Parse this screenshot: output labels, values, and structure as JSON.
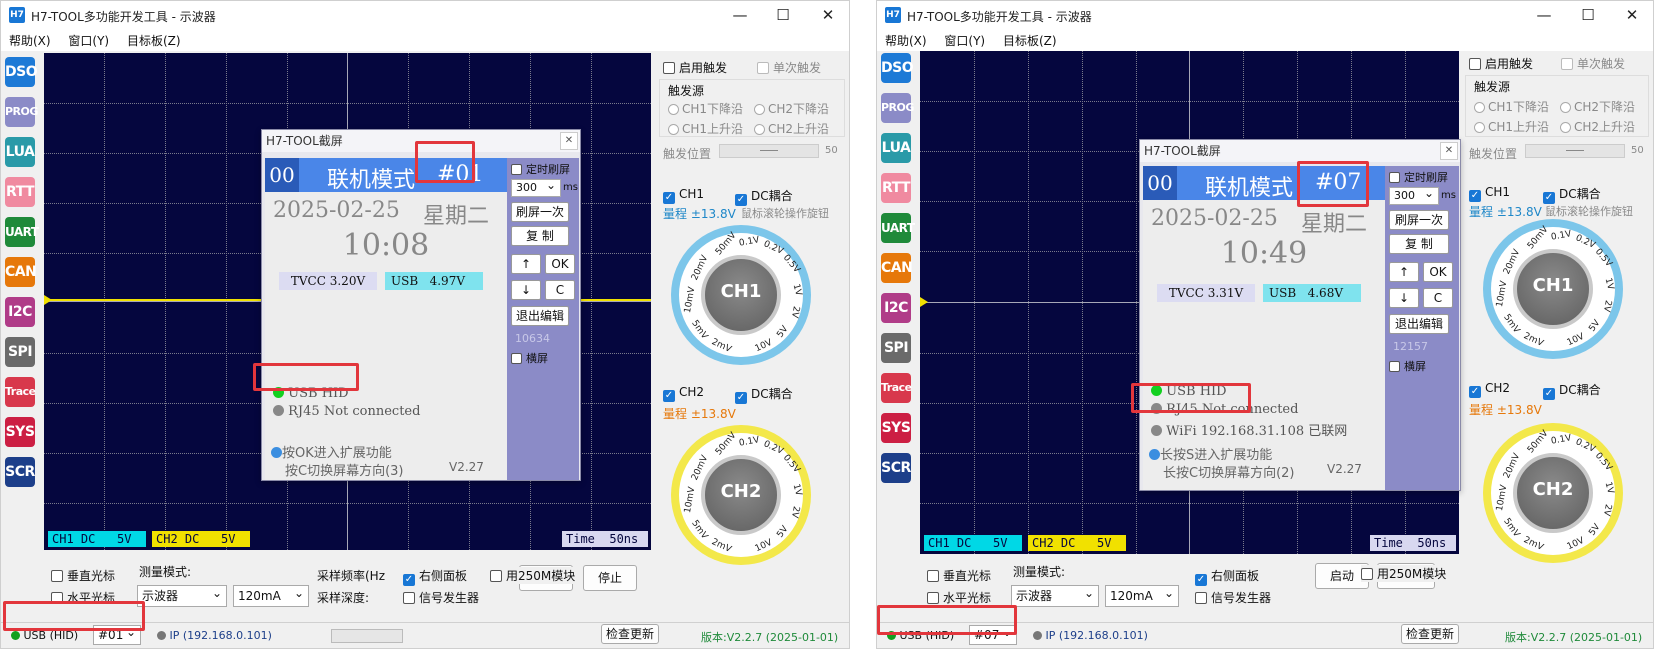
{
  "app": {
    "title": "H7-TOOL多功能开发工具 - 示波器",
    "icon": "H7",
    "menu": [
      "帮助(X)",
      "窗口(Y)",
      "目标板(Z)"
    ]
  },
  "sidebar": [
    "DSO",
    "PROG",
    "LUA",
    "RTT",
    "UART",
    "CAN",
    "I2C",
    "SPI",
    "Trace",
    "SYS",
    "SCR"
  ],
  "sidebar_colors": [
    "#1d7ad6",
    "#8b8bc7",
    "#2a9aa8",
    "#f08aa0",
    "#1f8a3a",
    "#e6780a",
    "#b03c88",
    "#6a6a6a",
    "#d8384c",
    "#cc1f43",
    "#1d3f8a"
  ],
  "scope": {
    "ch1_status": "CH1 DC   5V",
    "ch2_status": "CH2 DC   5V",
    "time_status": "Time  50ns"
  },
  "right": {
    "trigger_enable": "启用触发",
    "single_trigger": "单次触发",
    "trigger_source": "触发源",
    "ch1_fall": "CH1下降沿",
    "ch2_fall": "CH2下降沿",
    "ch1_rise": "CH1上升沿",
    "ch2_rise": "CH2上升沿",
    "trigger_pos": "触发位置",
    "trigger_pos_value": "50",
    "ch1": "CH1",
    "dc_couple": "DC耦合",
    "range1": "量程 ±13.8V",
    "wheel_hint": "鼠标滚轮操作旋钮",
    "ch2": "CH2",
    "range2": "量程 ±13.8V"
  },
  "knob": {
    "ch1": "CH1",
    "ch2": "CH2",
    "ticks": [
      "10mV",
      "20mV",
      "50mV",
      "0.1V",
      "0.2V",
      "0.5V",
      "1V",
      "2V",
      "5V",
      "10V",
      "2mV",
      "5mV"
    ]
  },
  "bottom": {
    "cursor_v": "垂直光标",
    "cursor_h": "水平光标",
    "measure_mode": "测量模式:",
    "mode_value": "示波器",
    "current_value": "120mA",
    "sample_rate": "采样频率(Hz",
    "sample_depth": "采样深度:",
    "right_panel": "右侧面板",
    "signal_gen": "信号发生器",
    "use_250m": "用250M模块",
    "stop": "停止",
    "start": "启动"
  },
  "status": {
    "usb": "USB (HID)",
    "ip": "IP (192.168.0.101)",
    "check_update": "检查更新",
    "version": "版本:V2.2.7 (2025-01-01)"
  },
  "popup": {
    "title": "H7-TOOL截屏",
    "timed_refresh": "定时刷屏",
    "refresh_ms": "300",
    "ms": "ms",
    "refresh_once": "刷屏一次",
    "copy": "复 制",
    "up": "↑",
    "ok": "OK",
    "down": "↓",
    "c": "C",
    "exit_edit": "退出编辑",
    "landscape": "横屏",
    "online_mode": "联机模式",
    "date": "2025-02-25",
    "weekday": "星期二",
    "tvcc_label": "TVCC",
    "usb_label": "USB",
    "usb_hid": "USB HID",
    "rj45": "RJ45 Not connected"
  },
  "left": {
    "device": "#01",
    "hdr_num": "00",
    "hdr_id": "#01",
    "time": "10:08",
    "tvcc": "3.20V",
    "usb_v": "4.97V",
    "counter": "10634",
    "hint1": "按OK进入扩展功能",
    "hint2": "按C切换屏幕方向(3)",
    "ver": "V2.27"
  },
  "right_win": {
    "device": "#07",
    "hdr_num": "00",
    "hdr_id": "#07",
    "time": "10:49",
    "tvcc": "3.31V",
    "usb_v": "4.68V",
    "counter": "12157",
    "wifi": "WiFi 192.168.31.108 已联网",
    "hint1": "长按S进入扩展功能",
    "hint2": "长按C切换屏幕方向(2)",
    "ver": "V2.27"
  }
}
